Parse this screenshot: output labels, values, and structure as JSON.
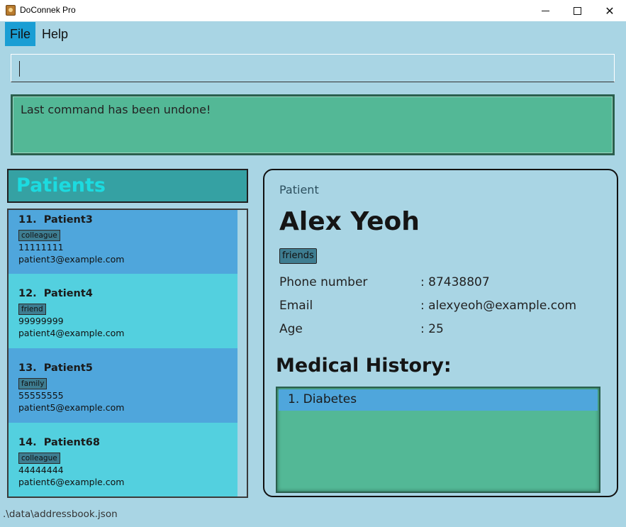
{
  "window": {
    "title": "DoConnek Pro",
    "minimize": "",
    "maximize": "",
    "close": "✕"
  },
  "menu": {
    "file": "File",
    "help": "Help"
  },
  "command_box": {
    "value": ""
  },
  "result_display": {
    "text": "Last command has been undone!"
  },
  "patients_panel": {
    "title": "Patients",
    "items": [
      {
        "index": "11.",
        "name": "Patient3",
        "tag": "colleague",
        "phone": "11111111",
        "email": "patient3@example.com"
      },
      {
        "index": "12.",
        "name": "Patient4",
        "tag": "friend",
        "phone": "99999999",
        "email": "patient4@example.com"
      },
      {
        "index": "13.",
        "name": "Patient5",
        "tag": "family",
        "phone": "55555555",
        "email": "patient5@example.com"
      },
      {
        "index": "14.",
        "name": "Patient68",
        "tag": "colleague",
        "phone": "44444444",
        "email": "patient6@example.com"
      }
    ]
  },
  "detail_panel": {
    "label": "Patient",
    "name": "Alex Yeoh",
    "tag": "friends",
    "fields": [
      {
        "key": "Phone number",
        "value": ": 87438807"
      },
      {
        "key": "Email",
        "value": ": alexyeoh@example.com"
      },
      {
        "key": "Age",
        "value": ": 25"
      }
    ],
    "history_title": "Medical History:",
    "history": [
      {
        "text": "1.  Diabetes"
      }
    ]
  },
  "status_bar": {
    "path": ".\\data\\addressbook.json"
  },
  "colors": {
    "background": "#a9d5e4",
    "result_bg": "#53b896",
    "card_dark": "#4fa6dc",
    "card_light": "#53d0df",
    "header_bg": "#35a1a3",
    "header_text": "#1cdbe0",
    "tag_bg": "#3e7d91",
    "menu_selected": "#1a9ed4"
  }
}
